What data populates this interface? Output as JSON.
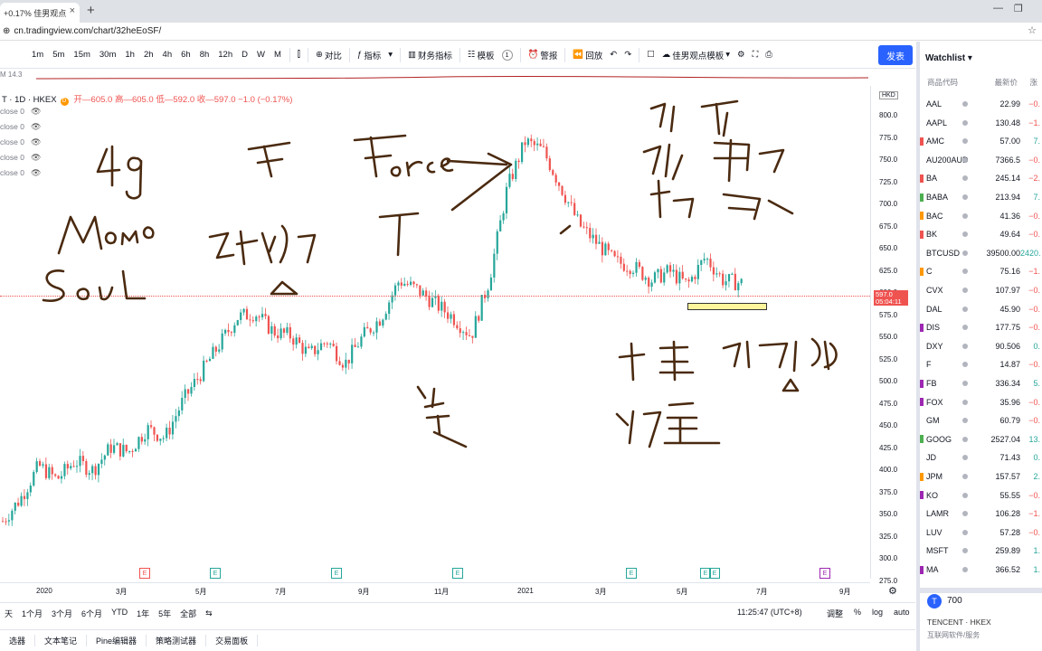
{
  "browser": {
    "tab_title": "+0.17% 佳男观点",
    "new_tab": "+",
    "address": "cn.tradingview.com/chart/32heEoSF/"
  },
  "toolbar": {
    "timeframes": [
      "1m",
      "5m",
      "15m",
      "30m",
      "1h",
      "2h",
      "4h",
      "6h",
      "8h",
      "12h",
      "D",
      "W",
      "M"
    ],
    "compare": "对比",
    "indicators": "指标",
    "financials": "财务指标",
    "templates": "模板",
    "template_count": "1",
    "alert": "警报",
    "replay": "回放",
    "layout_name": "佳男观点模板",
    "publish": "发表"
  },
  "legend": {
    "symbol": "T · 1D · HKEX",
    "currency_badge": "D",
    "ohlc": "开—605.0 高—605.0 低—592.0 收—597.0 −1.0 (−0.17%)",
    "indicators": [
      "close 0",
      "close 0",
      "close 0",
      "close 0",
      "close 0"
    ],
    "top_indicator": "M 14.3"
  },
  "price_axis": {
    "currency": "HKD",
    "labels": [
      "800.0",
      "775.0",
      "750.0",
      "725.0",
      "700.0",
      "675.0",
      "650.0",
      "625.0",
      "600.0",
      "575.0",
      "550.0",
      "525.0",
      "500.0",
      "475.0",
      "450.0",
      "425.0",
      "400.0",
      "375.0",
      "350.0",
      "325.0",
      "300.0",
      "275.0"
    ],
    "current_price": "597.0",
    "countdown": "05:04:11"
  },
  "time_axis": {
    "labels": [
      "2020",
      "3月",
      "5月",
      "7月",
      "9月",
      "11月",
      "2021",
      "3月",
      "5月",
      "7月",
      "9月"
    ]
  },
  "earnings_markers": [
    "E",
    "E",
    "E",
    "E",
    "E",
    "E",
    "E",
    "E"
  ],
  "range_bar": {
    "items": [
      "天",
      "1个月",
      "3个月",
      "6个月",
      "YTD",
      "1年",
      "5年",
      "全部"
    ],
    "compare_icon": "⇆",
    "clock": "11:25:47 (UTC+8)",
    "options": [
      "调整",
      "%",
      "log",
      "auto"
    ]
  },
  "bottom_tabs": [
    "选器",
    "文本笔记",
    "Pine编辑器",
    "策略测试器",
    "交易面板"
  ],
  "watchlist": {
    "title": "Watchlist",
    "col_symbol": "商品代码",
    "col_last": "最新价",
    "col_change": "涨",
    "rows": [
      {
        "symbol": "AAL",
        "last": "22.99",
        "chg": "−0.",
        "marker": ""
      },
      {
        "symbol": "AAPL",
        "last": "130.48",
        "chg": "−1.",
        "marker": ""
      },
      {
        "symbol": "AMC",
        "last": "57.00",
        "chg": "7.",
        "marker": "#ef5350"
      },
      {
        "symbol": "AU200AUD",
        "last": "7366.5",
        "chg": "−0.",
        "marker": ""
      },
      {
        "symbol": "BA",
        "last": "245.14",
        "chg": "−2.",
        "marker": "#ef5350"
      },
      {
        "symbol": "BABA",
        "last": "213.94",
        "chg": "7.",
        "marker": "#4caf50"
      },
      {
        "symbol": "BAC",
        "last": "41.36",
        "chg": "−0.",
        "marker": "#ff9800"
      },
      {
        "symbol": "BK",
        "last": "49.64",
        "chg": "−0.",
        "marker": "#ef5350"
      },
      {
        "symbol": "BTCUSD",
        "last": "39500.00",
        "chg": "2420.",
        "marker": ""
      },
      {
        "symbol": "C",
        "last": "75.16",
        "chg": "−1.",
        "marker": "#ff9800"
      },
      {
        "symbol": "CVX",
        "last": "107.97",
        "chg": "−0.",
        "marker": ""
      },
      {
        "symbol": "DAL",
        "last": "45.90",
        "chg": "−0.",
        "marker": ""
      },
      {
        "symbol": "DIS",
        "last": "177.75",
        "chg": "−0.",
        "marker": "#9c27b0"
      },
      {
        "symbol": "DXY",
        "last": "90.506",
        "chg": "0.",
        "marker": ""
      },
      {
        "symbol": "F",
        "last": "14.87",
        "chg": "−0.",
        "marker": ""
      },
      {
        "symbol": "FB",
        "last": "336.34",
        "chg": "5.",
        "marker": "#9c27b0"
      },
      {
        "symbol": "FOX",
        "last": "35.96",
        "chg": "−0.",
        "marker": "#9c27b0"
      },
      {
        "symbol": "GM",
        "last": "60.79",
        "chg": "−0.",
        "marker": ""
      },
      {
        "symbol": "GOOG",
        "last": "2527.04",
        "chg": "13.",
        "marker": "#4caf50"
      },
      {
        "symbol": "JD",
        "last": "71.43",
        "chg": "0.",
        "marker": ""
      },
      {
        "symbol": "JPM",
        "last": "157.57",
        "chg": "2.",
        "marker": "#ff9800"
      },
      {
        "symbol": "KO",
        "last": "55.55",
        "chg": "−0.",
        "marker": "#9c27b0"
      },
      {
        "symbol": "LAMR",
        "last": "106.28",
        "chg": "−1.",
        "marker": ""
      },
      {
        "symbol": "LUV",
        "last": "57.28",
        "chg": "−0.",
        "marker": ""
      },
      {
        "symbol": "MSFT",
        "last": "259.89",
        "chg": "1.",
        "marker": ""
      },
      {
        "symbol": "MA",
        "last": "366.52",
        "chg": "1.",
        "marker": "#9c27b0"
      }
    ]
  },
  "detail": {
    "logo": "T",
    "code": "700",
    "name": "TENCENT",
    "exchange": "HKEX",
    "sub": "互联网软件/服务"
  },
  "annotations": {
    "t1": "4g",
    "t2": "Momo",
    "t3": "Soul",
    "t4": "F",
    "t5": "Force",
    "t6": "全",
    "t7": "酒",
    "t8": "你",
    "t9": "电路",
    "t10": "位",
    "t11": "电池",
    "t12": "下跌",
    "t13": "放量",
    "t14": "跌",
    "t15": "强烈"
  },
  "colors": {
    "up": "#26a69a",
    "down": "#ef5350",
    "accent": "#2962ff",
    "ink": "#4a2a10"
  },
  "chart_data": {
    "type": "candlestick",
    "ylim": [
      275,
      810
    ],
    "current": 597.0,
    "x": [
      "2020-01",
      "2020-03",
      "2020-05",
      "2020-07",
      "2020-09",
      "2020-11",
      "2021-01",
      "2021-03",
      "2021-05",
      "2021-07",
      "2021-09"
    ],
    "close_path": [
      340,
      365,
      400,
      385,
      405,
      395,
      420,
      415,
      440,
      430,
      470,
      500,
      530,
      560,
      565,
      545,
      540,
      520,
      535,
      510,
      540,
      560,
      600,
      590,
      575,
      560,
      540,
      600,
      700,
      750,
      740,
      700,
      660,
      640,
      620,
      615,
      600,
      610,
      595,
      625,
      600,
      597
    ]
  }
}
